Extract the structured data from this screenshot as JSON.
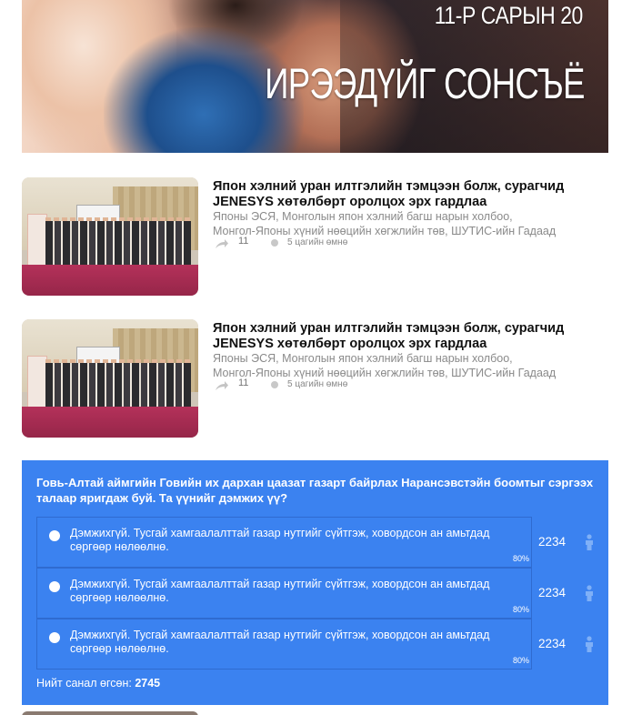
{
  "hero": {
    "date_text": "11-Р САРЫН 20",
    "title": "ИРЭЭДҮЙГ СОНСЪЁ"
  },
  "articles": [
    {
      "title": "Япон хэлний уран илтгэлийн тэмцээн болж, сурагчид JENESYS хөтөлбөрт оролцох эрх гардлаа",
      "desc_line1": "Японы ЭСЯ, Монголын япон хэлний багш нарын холбоо,",
      "desc_line2": "Монгол-Японы хүний нөөцийн хөгжлийн төв, ШУТИС-ийн Гадаад",
      "shares": "11",
      "time": "5 цагийн өмнө",
      "share_icon": "share-icon",
      "clock_icon": "clock-icon"
    },
    {
      "title": "Япон хэлний уран илтгэлийн тэмцээн болж, сурагчид JENESYS хөтөлбөрт оролцох эрх гардлаа",
      "desc_line1": "Японы ЭСЯ, Монголын япон хэлний багш нарын холбоо,",
      "desc_line2": "Монгол-Японы хүний нөөцийн хөгжлийн төв, ШУТИС-ийн Гадаад",
      "shares": "11",
      "time": "5 цагийн өмнө",
      "share_icon": "share-icon",
      "clock_icon": "clock-icon"
    }
  ],
  "poll": {
    "question": "Говь-Алтай аймгийн Говийн их дархан цаазат газарт байрлах Нарансэвстэйн боомтыг сэргээх талаар яригдаж буй. Та үүнийг дэмжих үү?",
    "options": [
      {
        "label": "Дэмжихгүй. Тусгай хамгаалалттай газар нутгийг сүйтгэж, ховордсон ан амьтдад сөргөөр нөлөөлнө.",
        "percent_text": "80%",
        "percent": 80,
        "count": "2234"
      },
      {
        "label": "Дэмжихгүй. Тусгай хамгаалалттай газар нутгийг сүйтгэж, ховордсон ан амьтдад сөргөөр нөлөөлнө.",
        "percent_text": "80%",
        "percent": 80,
        "count": "2234"
      },
      {
        "label": "Дэмжихгүй. Тусгай хамгаалалттай газар нутгийг сүйтгэж, ховордсон ан амьтдад сөргөөр нөлөөлнө.",
        "percent_text": "80%",
        "percent": 80,
        "count": "2234"
      }
    ],
    "total_label": "Нийт санал өгсөн:",
    "total_value": "2745",
    "vote_icon": "person-icon",
    "colors": {
      "background": "#3b82f0",
      "border": "#2f6bd0",
      "text": "#ffffff"
    }
  },
  "chart_data": {
    "type": "table",
    "title": "Говь-Алтай аймгийн Говийн их дархан цаазат газарт байрлах Нарансэвстэйн боомтыг сэргээх талаар яригдаж буй. Та үүнийг дэмжих үү?",
    "categories": [
      "Дэмжихгүй. Тусгай хамгаалалттай газар нутгийг сүйтгэж, ховордсон ан амьтдад сөргөөр нөлөөлнө.",
      "Дэмжихгүй. Тусгай хамгаалалттай газар нутгийг сүйтгэж, ховордсон ан амьтдад сөргөөр нөлөөлнө.",
      "Дэмжихгүй. Тусгай хамгаалалттай газар нутгийг сүйтгэж, ховордсон ан амьтдад сөргөөр нөлөөлнө."
    ],
    "series": [
      {
        "values": [
          2234,
          2234,
          2234
        ]
      },
      {
        "values": [
          80,
          80,
          80
        ]
      }
    ],
    "total": 2745
  }
}
